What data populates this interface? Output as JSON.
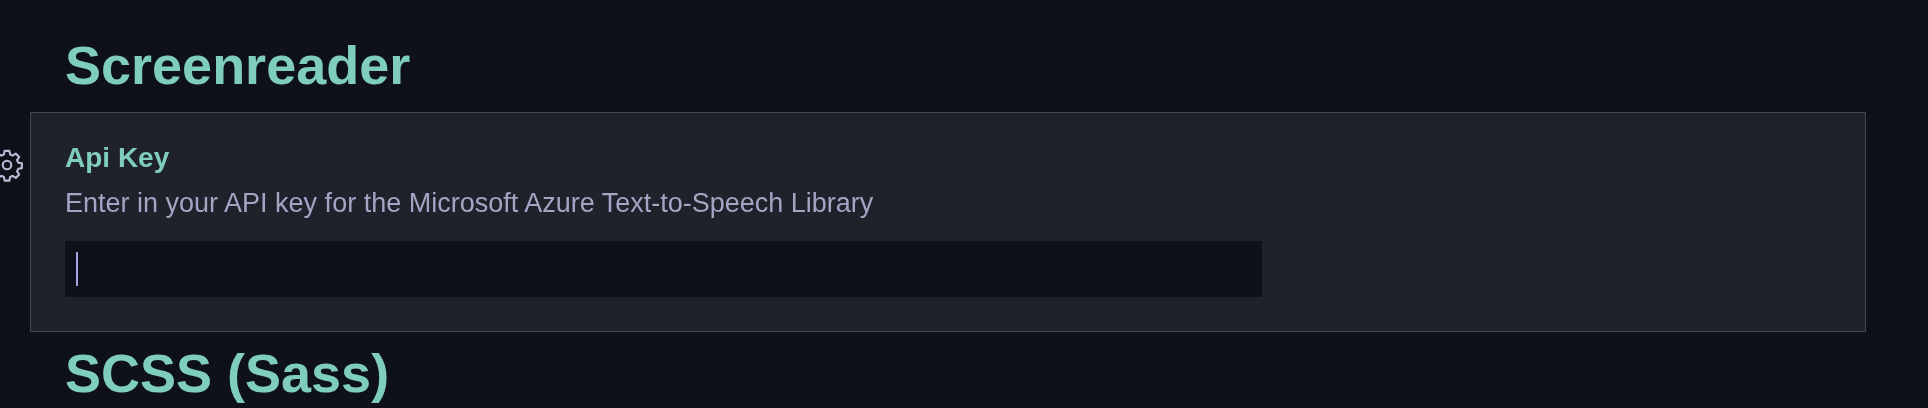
{
  "sections": [
    {
      "title": "Screenreader",
      "settings": [
        {
          "label": "Api Key",
          "description": "Enter in your API key for the Microsoft Azure Text-to-Speech Library",
          "focused": true
        }
      ]
    },
    {
      "title": "SCSS (Sass)"
    }
  ]
}
